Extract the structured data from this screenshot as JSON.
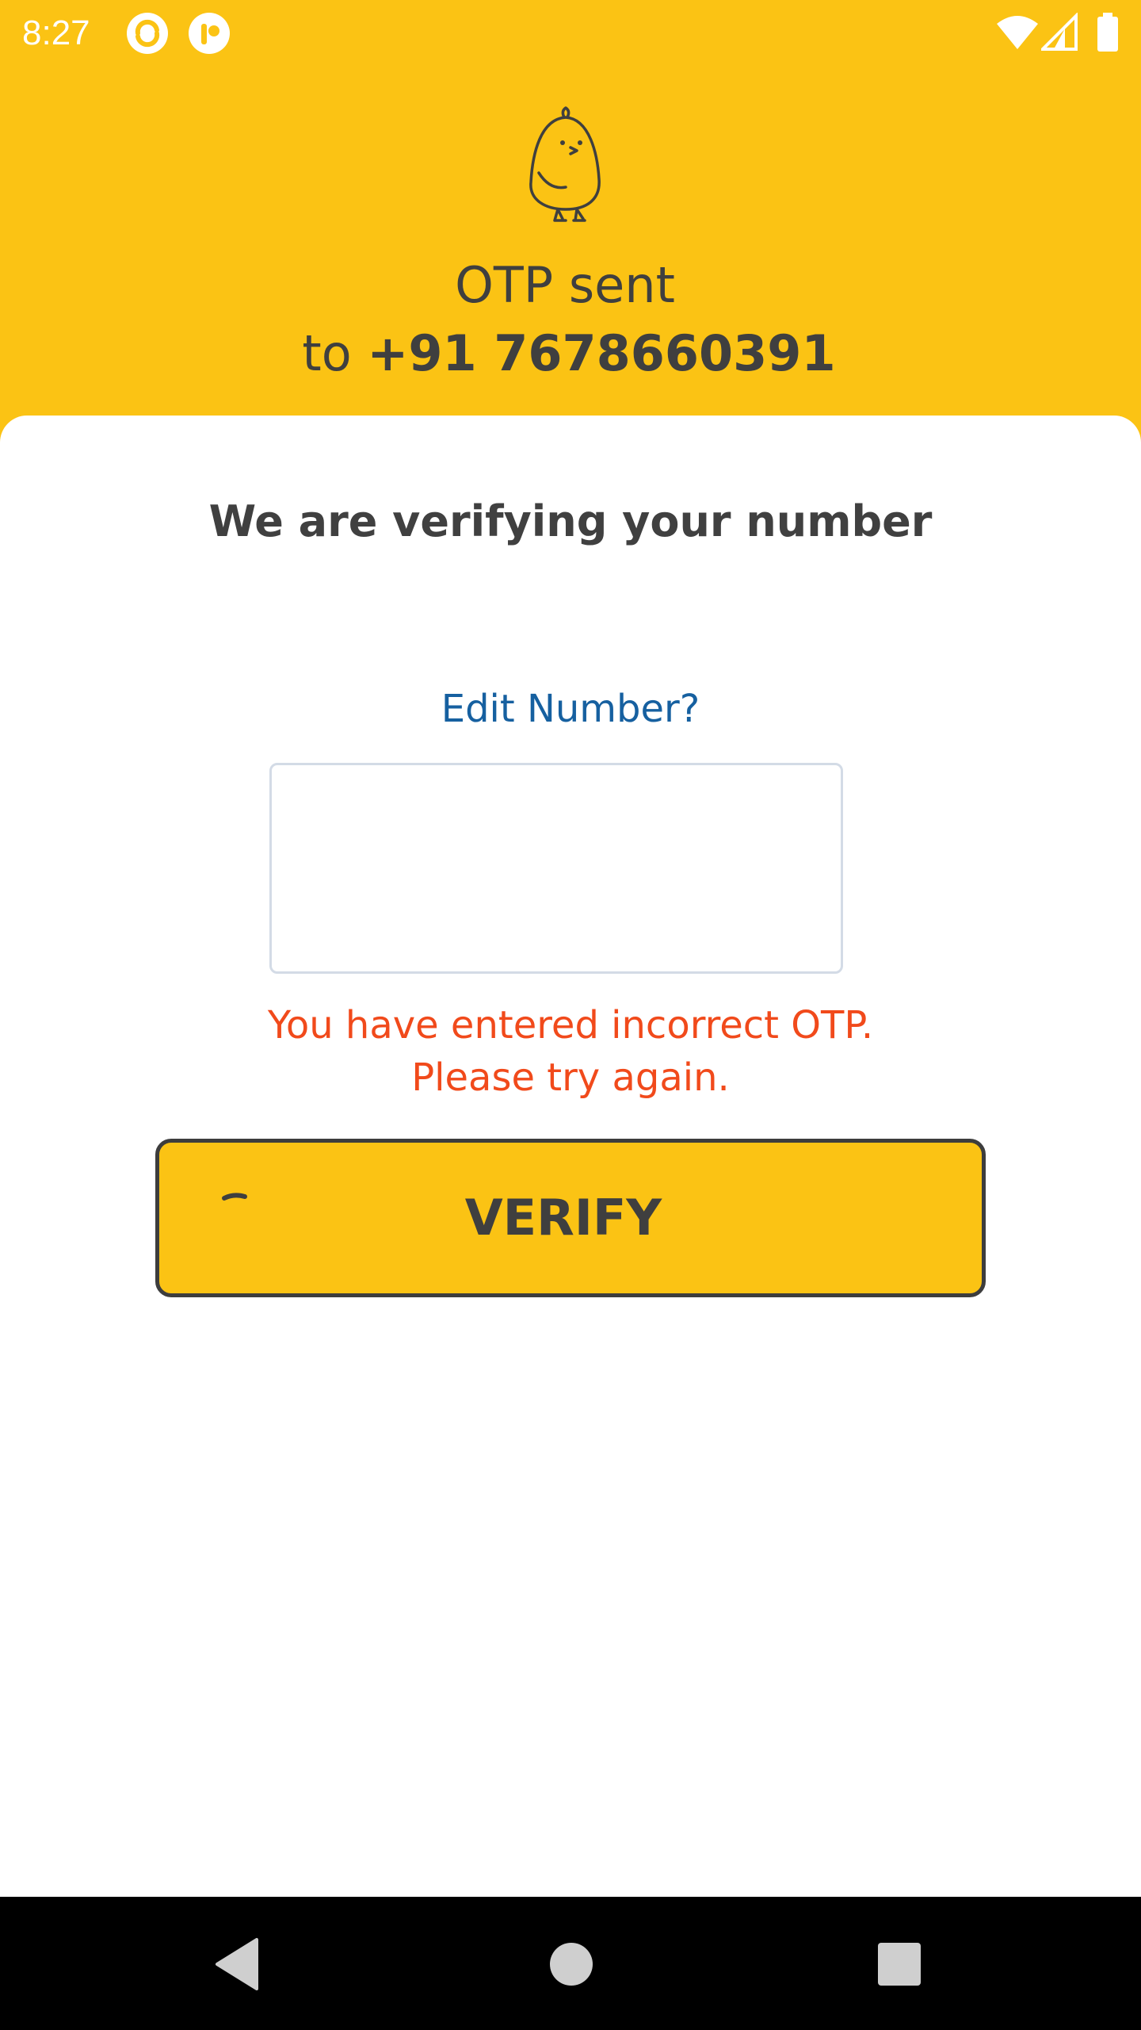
{
  "status_bar": {
    "time": "8:27",
    "icons": [
      "app-notification-icon",
      "koo-app-icon",
      "wifi-icon",
      "cellular-signal-icon",
      "battery-icon"
    ]
  },
  "header": {
    "mascot_icon": "chick-mascot-icon",
    "otp_title": "OTP sent",
    "otp_prefix": "to",
    "phone_number": "+91 7678660391",
    "background_color": "#FBC314"
  },
  "main": {
    "verifying_title": "We are verifying your number",
    "edit_number_link": "Edit Number?",
    "otp_input_value": "",
    "error_line1": "You have entered incorrect OTP.",
    "error_line2": "Please try again.",
    "verify_button": "VERIFY",
    "error_color": "#F14A1B",
    "link_color": "#1660A0"
  },
  "nav_bar": {
    "icons": [
      "back-icon",
      "home-icon",
      "recents-icon"
    ]
  }
}
